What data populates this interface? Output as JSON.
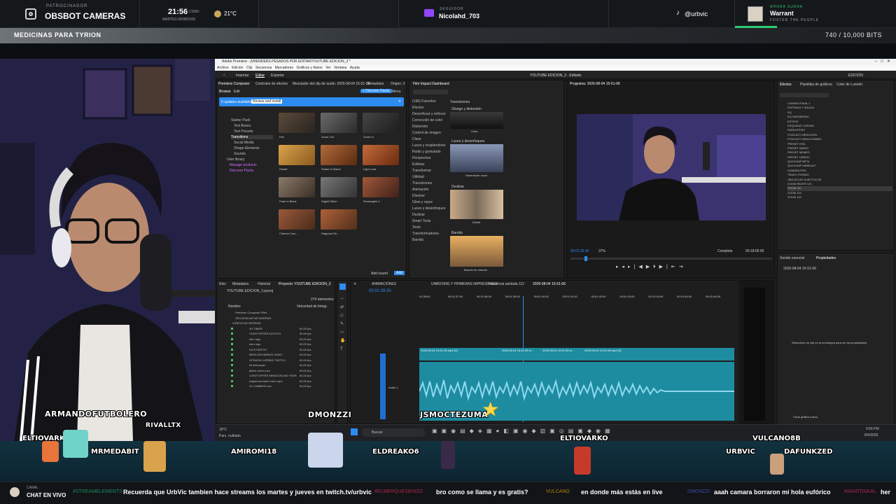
{
  "topbar": {
    "sponsor_label": "PATROCINADOR",
    "sponsor_name": "OBSBOT CAMERAS",
    "time": "21:56",
    "time_zone": "CDMX",
    "date": "MARTES 04/08/2026",
    "temperature": "21°C",
    "subscriber_label": "SEGUIDOR",
    "subscriber_name": "Nicolahd_703",
    "tiktok_handle": "@urbvic",
    "now_playing_label": "AHORA SUENA",
    "song_title": "Warrant",
    "song_artist": "FOSTER THE PEOPLE"
  },
  "goal": {
    "label": "MEDICINAS PARA TYRION",
    "value": "740 / 10,000 BITS",
    "progress_fraction": 0.074
  },
  "premiere": {
    "title": "Adobe Premiere - [VRENDERS PESADOS POR EDITAR/YOUTUBE EDICION_3 *",
    "menu": [
      "Archivo",
      "Edición",
      "Clip",
      "Secuencia",
      "Marcadores",
      "Gráficos y títulos",
      "Ver",
      "Ventana",
      "Ayuda"
    ],
    "workspace_tabs": [
      "Importar",
      "Editar",
      "Exportar"
    ],
    "sequence_title": "YOUTUBE EDICION_3 - Editado",
    "workspace_label": "EDICIÓN",
    "composer": {
      "tabs": [
        "Premiere Composer",
        "Controles de efectos",
        "Mezclador del clip de audio: 2026-08-04 15-51-06",
        "Metadatos",
        "Origen: 2"
      ],
      "subtabs": [
        "Browse",
        "Edit"
      ],
      "discover_button": "+ Discover Packs",
      "menu_button": "Menu",
      "update_text": "5 updates available",
      "update_button": "Review and install",
      "tree": [
        "Starter Pack",
        "Text Boxes",
        "Text Presets",
        "Transitions",
        "Social Media",
        "Shape Elements",
        "Sounds",
        "User library",
        "Manage products",
        "Discover Packs"
      ],
      "thumbs": [
        "Pan",
        "Zoom Out",
        "Zoom In",
        "Rotate",
        "Shake & Distort",
        "Light Leak",
        "Fade to Black",
        "Digital Glitch",
        "Rectangles 2...",
        "Cinema Com...",
        "Diagonal Str..."
      ],
      "add_sound": "Add sound",
      "add_button": "Add"
    },
    "film_impact": {
      "title": "Film Impact Dashboard",
      "categories": [
        "(196) Favoritos",
        "Efectos",
        "Desenfocar y enfocar",
        "Corrección de color",
        "Distorsión",
        "Control de imagen",
        "Clave",
        "Luces y resplandores",
        "Ruido y granulado",
        "Perspectiva",
        "Estilizar",
        "Transformar",
        "Utilidad",
        "Transiciones",
        "Animación",
        "Disolver",
        "Glow y rayos",
        "Luces y desenfoques",
        "Deslizar",
        "Smart Tools",
        "Texto",
        "Transformadores",
        "Barrido"
      ],
      "sections": [
        "Transiciones",
        "Glunge y distorsión",
        "Luces y desenfoques",
        "Deslizar",
        "Barrido"
      ],
      "items": [
        "Caos",
        "Desenfocar zoom",
        "Dividir",
        "Barrido de maneta"
      ]
    },
    "program": {
      "label": "Programa: 2026-08-04 15-51-06",
      "timecode": "00:01:39:30",
      "zoom": "37%",
      "quality": "Completa",
      "duration": "00:18:05:05"
    },
    "effects": {
      "tabs": [
        "Efectos",
        "Plantillas de gráficos",
        "Color de Lumetri"
      ],
      "items": [
        "CAMARA FINAL 1",
        "ENTRADA Y SALIDA",
        "EQ",
        "EQ SARAMONIC",
        "ESTEFA",
        "ESQUINAS CURVAS",
        "PARENTESIS",
        "PODCAST MEDIA ERA",
        "PODCAST MEDIA RAMBO",
        "PRESET ERA",
        "PRESET MARIO",
        "PRESET MEMES",
        "PRESET URBVIC",
        "QUICKWIP BETA",
        "QUICKWIP MRBEAST",
        "SOMBRA PRO",
        "TRAZO FORMIO",
        "UBICACION SUBTITULOS",
        "ZOOM REZER 120",
        "ZOOM 110",
        "ZOOM 104",
        "ZOOM 120"
      ]
    },
    "properties": {
      "tabs": [
        "Sonido esencial",
        "Propiedades"
      ],
      "clip": "2026-08-04 15-51-06",
      "empty_text": "Seleccione un clip en la cronología para ver las propiedades.",
      "new_graphic": "Crear gráfico nuevo"
    },
    "project": {
      "tabs": [
        "Efec",
        "Metadatos",
        "Historial",
        "Proyecto: YOUTUBE EDICION_3"
      ],
      "filename": "YOUTUBE EDICION_3.prproj",
      "count": "274 elementos",
      "col_name": "Nombre",
      "col_rate": "Velocidad de fotogr.",
      "folders": [
        "Premiere Composer Files",
        "SECUENCIAS NO BORRAR",
        "VIDEOS NO BORRAR"
      ],
      "files": [
        {
          "name": "4G TIMER",
          "rate": "60,00 fps"
        },
        {
          "name": "CDKEYOFFER AGOSTO",
          "rate": "60,00 fps"
        },
        {
          "name": "intro logo",
          "rate": "60,00 fps"
        },
        {
          "name": "intro logo",
          "rate": "60,00 fps"
        },
        {
          "name": "KICKTWITCH",
          "rate": "60,00 fps"
        },
        {
          "name": "MENCION MEBUS JUNIO",
          "rate": "60,00 fps"
        },
        {
          "name": "OPINION LUREBIS TWITCH",
          "rate": "60,00 fps"
        },
        {
          "name": "bedula paper",
          "rate": "60,00 fps"
        },
        {
          "name": "jibelel-video.mov",
          "rate": "60,00 fps"
        },
        {
          "name": "CDKEYOFFER MENCION MID YEAR",
          "rate": "60,00 fps"
        },
        {
          "name": "fragmento-twitch-intro.mp4",
          "rate": "60,00 fps"
        },
        {
          "name": "IG LOMBRIS.mov",
          "rate": "60,00 fps"
        }
      ]
    },
    "timeline": {
      "tabs": [
        "ANIMACIONES",
        "UNBOXING Y PRIMERAS IMPRESIONES",
        "Secuencia anidada 112",
        "2026-08-04 15-51-06"
      ],
      "timecode": "00:01:39:30",
      "ruler": [
        "01:38:00",
        "00:01:37:00",
        "00:01:38:00",
        "00:01:39:00",
        "00:01:40:00",
        "00:01:41:00",
        "00:01:42:00",
        "00:01:43:00",
        "00:01:44:00",
        "00:01:45:00",
        "00:01:46:00"
      ],
      "clips": [
        "2026-08-04 15-51-06.mp4 [V]",
        "2026-08-04 15-51-06.m...",
        "2026-08-04 15-51-06.m...",
        "2026-08-04 15-51-06.mp4 [V]"
      ],
      "audio_label": "Audio 1"
    }
  },
  "taskbar": {
    "weather": "18°C",
    "weather_desc": "Parc. nublado",
    "search_placeholder": "Buscar",
    "time": "9:56 PM",
    "date": "8/4/2026"
  },
  "overlay_names": [
    "ARMANDOFUTBOLERO",
    "RIVALLTX",
    "DMONZZI",
    "JSMOCTEZUMA",
    "ELTIOVARKO",
    "MRMEDABIT",
    "AMIROMI18",
    "ELDREAKO6",
    "ELTIOVARKO",
    "URBVIC",
    "VULCANO8B",
    "DAFUNKZED"
  ],
  "chat": {
    "channel_label": "CANAL",
    "channel_name": "CHAT EN VIVO",
    "messages": [
      {
        "user": "#STREAMELEMENTS",
        "text": "Recuerda que UrbVic tambien hace streams los martes y jueves en twitch.tv/urbvic",
        "color": "#1e8a5a"
      },
      {
        "user": "#ELMERQUESEHIZO",
        "text": "bro como se llama y es gratis?",
        "color": "#b0284a"
      },
      {
        "user": "VULCANO",
        "text": "en donde más estás en live",
        "color": "#b8860b"
      },
      {
        "user": "DMONZZI",
        "text": "aaah camara borraron mi hola eufórico",
        "color": "#3a4fa8"
      },
      {
        "user": "#SANTOSKAL",
        "text": "her",
        "color": "#b0284a"
      }
    ]
  },
  "colors": {
    "accent_blue": "#2d8cf0",
    "timeline_teal": "#1d8ca0",
    "audio_wave": "#8fd8f0",
    "twitch_purple": "#9146ff"
  }
}
